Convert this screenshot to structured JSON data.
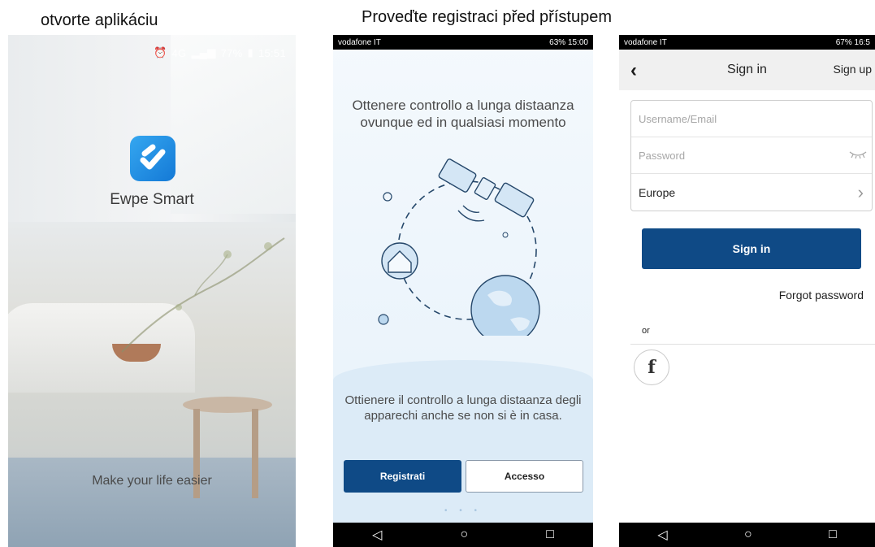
{
  "captions": {
    "left": "otvorte aplikáciu",
    "right": "Proveďte registraci před přístupem"
  },
  "screen1": {
    "status": {
      "network": "4G",
      "battery": "77%",
      "time": "15:51"
    },
    "app_icon": "ewpe-smart-logo",
    "app_name": "Ewpe Smart",
    "tagline": "Make your life easier"
  },
  "screen2": {
    "status": {
      "carrier": "vodafone IT",
      "battery": "63%",
      "time": "15:00"
    },
    "headline": "Ottenere controllo a lunga distaanza ovunque ed in qualsiasi momento",
    "description": "Ottienere il controllo a lunga distaanza degli apparechi anche se non si è in casa.",
    "buttons": {
      "register": "Registrati",
      "access": "Accesso"
    },
    "pager": "• • •",
    "nav": {
      "back": "◁",
      "home": "○",
      "recent": "□"
    }
  },
  "screen3": {
    "status": {
      "carrier": "vodafone IT",
      "battery": "67%",
      "time": "16:5"
    },
    "appbar": {
      "back": "‹",
      "title": "Sign in",
      "signup": "Sign up"
    },
    "form": {
      "username_placeholder": "Username/Email",
      "password_placeholder": "Password",
      "region": "Europe"
    },
    "signin_button": "Sign in",
    "forgot_password": "Forgot password",
    "or_label": "or",
    "facebook": "f",
    "nav": {
      "back": "◁",
      "home": "○",
      "recent": "□"
    }
  },
  "colors": {
    "primary": "#0f4a86",
    "icon": "#1d8ae6"
  }
}
